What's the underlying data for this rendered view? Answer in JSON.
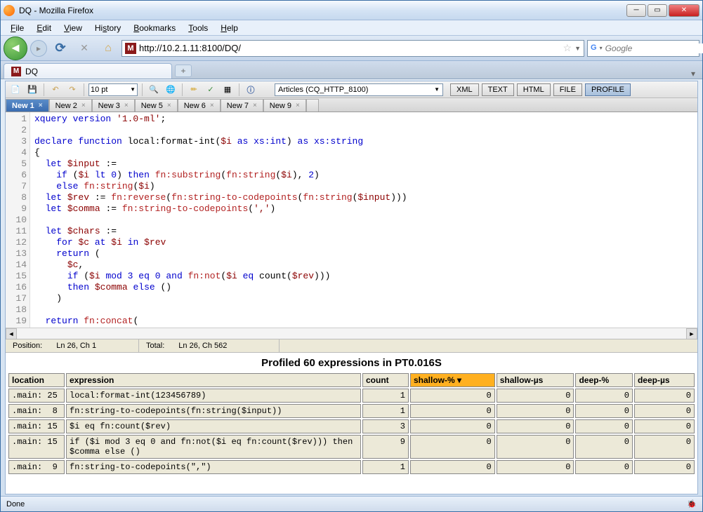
{
  "window": {
    "title": "DQ - Mozilla Firefox"
  },
  "menubar": [
    "File",
    "Edit",
    "View",
    "History",
    "Bookmarks",
    "Tools",
    "Help"
  ],
  "navbar": {
    "url": "http://10.2.1.11:8100/DQ/",
    "search_placeholder": "Google"
  },
  "browser_tab": {
    "label": "DQ"
  },
  "toolbar": {
    "font_size": "10 pt",
    "datasource": "Articles (CQ_HTTP_8100)",
    "buttons": [
      "XML",
      "TEXT",
      "HTML",
      "FILE",
      "PROFILE"
    ],
    "active_button": "PROFILE"
  },
  "editor_tabs": [
    "New 1",
    "New 2",
    "New 3",
    "New 5",
    "New 6",
    "New 7",
    "New 9"
  ],
  "editor_active_tab": "New 1",
  "code_lines": [
    {
      "n": 1,
      "html": "<span class='kw'>xquery version</span> <span class='str'>'1.0-ml'</span>;"
    },
    {
      "n": 2,
      "html": ""
    },
    {
      "n": 3,
      "html": "<span class='kw'>declare function</span> local:format-int(<span class='var'>$i</span> <span class='kw'>as</span> <span class='type'>xs:int</span>) <span class='kw'>as</span> <span class='type'>xs:string</span>"
    },
    {
      "n": 4,
      "html": "{"
    },
    {
      "n": 5,
      "html": "  <span class='kw'>let</span> <span class='var'>$input</span> :="
    },
    {
      "n": 6,
      "html": "    <span class='kw'>if</span> (<span class='var'>$i</span> <span class='kw'>lt</span> <span class='num'>0</span>) <span class='kw'>then</span> <span class='fn'>fn:substring</span>(<span class='fn'>fn:string</span>(<span class='var'>$i</span>), <span class='num'>2</span>)"
    },
    {
      "n": 7,
      "html": "    <span class='kw'>else</span> <span class='fn'>fn:string</span>(<span class='var'>$i</span>)"
    },
    {
      "n": 8,
      "html": "  <span class='kw'>let</span> <span class='var'>$rev</span> := <span class='fn'>fn:reverse</span>(<span class='fn'>fn:string-to-codepoints</span>(<span class='fn'>fn:string</span>(<span class='var'>$input</span>)))"
    },
    {
      "n": 9,
      "html": "  <span class='kw'>let</span> <span class='var'>$comma</span> := <span class='fn'>fn:string-to-codepoints</span>(<span class='str'>','</span>)"
    },
    {
      "n": 10,
      "html": ""
    },
    {
      "n": 11,
      "html": "  <span class='kw'>let</span> <span class='var'>$chars</span> :="
    },
    {
      "n": 12,
      "html": "    <span class='kw'>for</span> <span class='var'>$c</span> <span class='kw'>at</span> <span class='var'>$i</span> <span class='kw'>in</span> <span class='var'>$rev</span>"
    },
    {
      "n": 13,
      "html": "    <span class='kw'>return</span> ("
    },
    {
      "n": 14,
      "html": "      <span class='var'>$c</span>,"
    },
    {
      "n": 15,
      "html": "      <span class='kw'>if</span> (<span class='var'>$i</span> <span class='kw'>mod</span> <span class='num'>3</span> <span class='kw'>eq</span> <span class='num'>0</span> <span class='kw'>and</span> <span class='fn'>fn:not</span>(<span class='var'>$i</span> <span class='kw'>eq</span> count(<span class='var'>$rev</span>)))"
    },
    {
      "n": 16,
      "html": "      <span class='kw'>then</span> <span class='var'>$comma</span> <span class='kw'>else</span> ()"
    },
    {
      "n": 17,
      "html": "    )"
    },
    {
      "n": 18,
      "html": ""
    },
    {
      "n": 19,
      "html": "  <span class='kw'>return</span> <span class='fn'>fn:concat</span>("
    }
  ],
  "status": {
    "position_label": "Position:",
    "position_value": "Ln 26, Ch 1",
    "total_label": "Total:",
    "total_value": "Ln 26, Ch 562"
  },
  "results": {
    "title": "Profiled 60 expressions in PT0.016S",
    "columns": [
      "location",
      "expression",
      "count",
      "shallow-%",
      "shallow-µs",
      "deep-%",
      "deep-µs"
    ],
    "sorted_column": "shallow-%",
    "rows": [
      {
        "loc": ".main: 25",
        "expr": "local:format-int(123456789)",
        "count": 1,
        "sh_pct": 0,
        "sh_us": 0,
        "dp_pct": 0,
        "dp_us": 0
      },
      {
        "loc": ".main:  8",
        "expr": "fn:string-to-codepoints(fn:string($input))",
        "count": 1,
        "sh_pct": 0,
        "sh_us": 0,
        "dp_pct": 0,
        "dp_us": 0
      },
      {
        "loc": ".main: 15",
        "expr": "$i eq fn:count($rev)",
        "count": 3,
        "sh_pct": 0,
        "sh_us": 0,
        "dp_pct": 0,
        "dp_us": 0
      },
      {
        "loc": ".main: 15",
        "expr": "if ($i mod 3 eq 0 and fn:not($i eq fn:count($rev))) then $comma else ()",
        "count": 9,
        "sh_pct": 0,
        "sh_us": 0,
        "dp_pct": 0,
        "dp_us": 0
      },
      {
        "loc": ".main:  9",
        "expr": "fn:string-to-codepoints(\",\")",
        "count": 1,
        "sh_pct": 0,
        "sh_us": 0,
        "dp_pct": 0,
        "dp_us": 0
      }
    ]
  },
  "footer": {
    "status": "Done"
  }
}
